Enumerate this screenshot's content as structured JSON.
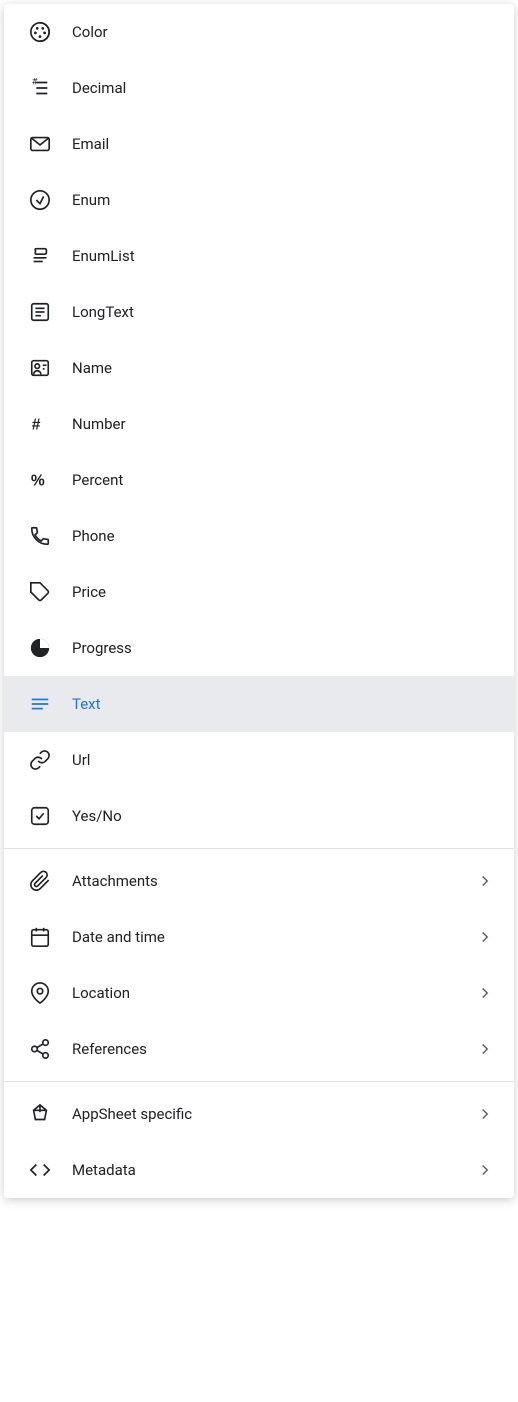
{
  "menu": {
    "items_basic": [
      {
        "id": "color",
        "label": "Color",
        "icon": "color-icon",
        "selected": false
      },
      {
        "id": "decimal",
        "label": "Decimal",
        "icon": "decimal-icon",
        "selected": false
      },
      {
        "id": "email",
        "label": "Email",
        "icon": "email-icon",
        "selected": false
      },
      {
        "id": "enum",
        "label": "Enum",
        "icon": "enum-icon",
        "selected": false
      },
      {
        "id": "enumlist",
        "label": "EnumList",
        "icon": "enumlist-icon",
        "selected": false
      },
      {
        "id": "longtext",
        "label": "LongText",
        "icon": "longtext-icon",
        "selected": false
      },
      {
        "id": "name",
        "label": "Name",
        "icon": "name-icon",
        "selected": false
      },
      {
        "id": "number",
        "label": "Number",
        "icon": "number-icon",
        "selected": false
      },
      {
        "id": "percent",
        "label": "Percent",
        "icon": "percent-icon",
        "selected": false
      },
      {
        "id": "phone",
        "label": "Phone",
        "icon": "phone-icon",
        "selected": false
      },
      {
        "id": "price",
        "label": "Price",
        "icon": "price-icon",
        "selected": false
      },
      {
        "id": "progress",
        "label": "Progress",
        "icon": "progress-icon",
        "selected": false
      },
      {
        "id": "text",
        "label": "Text",
        "icon": "text-icon",
        "selected": true
      },
      {
        "id": "url",
        "label": "Url",
        "icon": "url-icon",
        "selected": false
      },
      {
        "id": "yesno",
        "label": "Yes/No",
        "icon": "yesno-icon",
        "selected": false
      }
    ],
    "items_advanced": [
      {
        "id": "attachments",
        "label": "Attachments",
        "icon": "attachments-icon",
        "hasArrow": true
      },
      {
        "id": "datetime",
        "label": "Date and time",
        "icon": "datetime-icon",
        "hasArrow": true
      },
      {
        "id": "location",
        "label": "Location",
        "icon": "location-icon",
        "hasArrow": true
      },
      {
        "id": "references",
        "label": "References",
        "icon": "references-icon",
        "hasArrow": true
      }
    ],
    "items_special": [
      {
        "id": "appsheet",
        "label": "AppSheet specific",
        "icon": "appsheet-icon",
        "hasArrow": true
      },
      {
        "id": "metadata",
        "label": "Metadata",
        "icon": "metadata-icon",
        "hasArrow": true
      }
    ]
  }
}
